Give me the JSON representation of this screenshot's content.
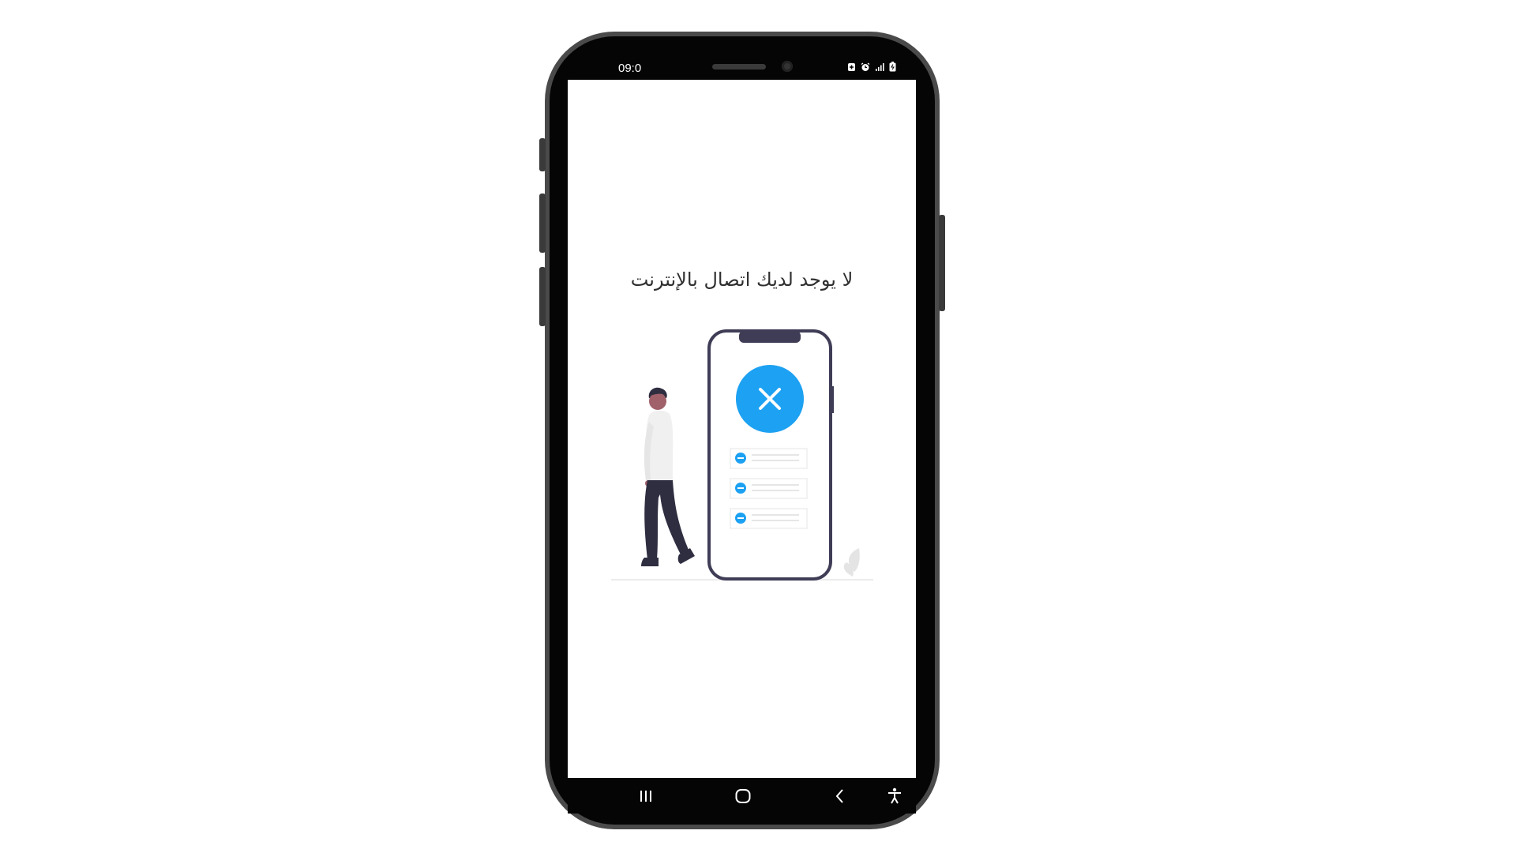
{
  "status_bar": {
    "time": "09:0",
    "icons": [
      "battery-saver-icon",
      "alarm-icon",
      "signal-icon",
      "battery-icon"
    ]
  },
  "screen": {
    "message": "لا يوجد لديك اتصال بالإنترنت",
    "illustration": "no-internet-illustration",
    "accent_color": "#1da1f2"
  },
  "navigation_bar": {
    "buttons": [
      "recent-apps-icon",
      "home-icon",
      "back-icon",
      "accessibility-icon"
    ]
  }
}
